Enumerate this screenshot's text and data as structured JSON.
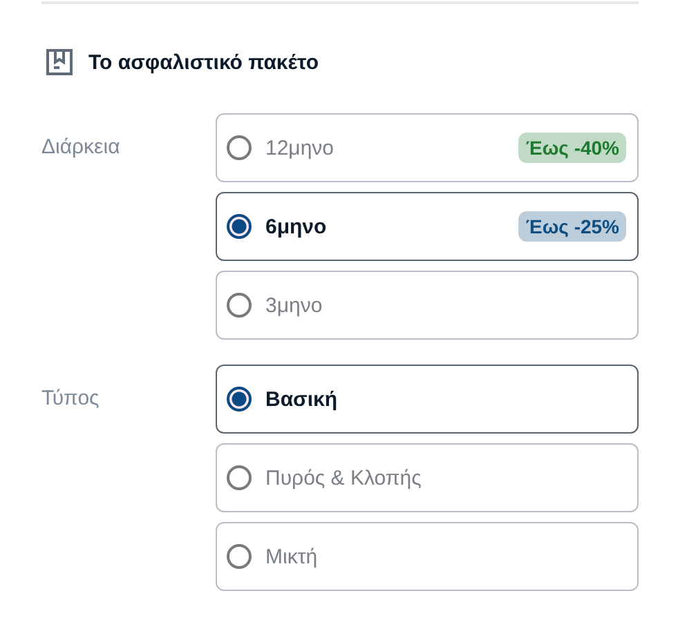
{
  "section": {
    "title": "Το ασφαλιστικό πακέτο"
  },
  "groups": [
    {
      "label": "Διάρκεια",
      "options": [
        {
          "label": "12μηνο",
          "selected": false,
          "badge": {
            "text": "Έως -40%",
            "color": "#1d7a30"
          }
        },
        {
          "label": "6μηνο",
          "selected": true,
          "badge": {
            "text": "Έως -25%",
            "color": "#0e4d80"
          }
        },
        {
          "label": "3μηνο",
          "selected": false
        }
      ]
    },
    {
      "label": "Τύπος",
      "options": [
        {
          "label": "Βασική",
          "selected": true
        },
        {
          "label": "Πυρός & Κλοπής",
          "selected": false
        },
        {
          "label": "Μικτή",
          "selected": false
        }
      ]
    }
  ]
}
